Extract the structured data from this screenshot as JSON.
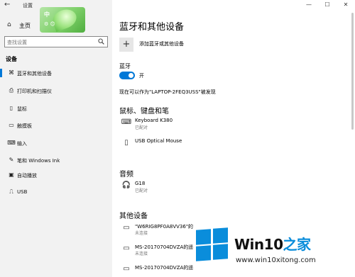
{
  "window": {
    "title": "设置",
    "controls": {
      "minimize": "—",
      "maximize": "☐",
      "close": "✕"
    }
  },
  "ime_badge": {
    "char": "中",
    "sym": "⚙ 😊"
  },
  "sidebar": {
    "home_label": "主页",
    "search_placeholder": "查找设置",
    "section_title": "设备",
    "items": [
      {
        "icon": "bluetooth-icon",
        "glyph": "⌘",
        "label": "蓝牙和其他设备"
      },
      {
        "icon": "printer-icon",
        "glyph": "⎙",
        "label": "打印机和扫描仪"
      },
      {
        "icon": "mouse-icon",
        "glyph": "▯",
        "label": "鼠标"
      },
      {
        "icon": "touchpad-icon",
        "glyph": "▭",
        "label": "触摸板"
      },
      {
        "icon": "keyboard-icon",
        "glyph": "⌨",
        "label": "输入"
      },
      {
        "icon": "pen-icon",
        "glyph": "✎",
        "label": "笔和 Windows Ink"
      },
      {
        "icon": "autoplay-icon",
        "glyph": "▣",
        "label": "自动播放"
      },
      {
        "icon": "usb-icon",
        "glyph": "⎍",
        "label": "USB"
      }
    ]
  },
  "main": {
    "title": "蓝牙和其他设备",
    "add_label": "添加蓝牙或其他设备",
    "bluetooth_heading": "蓝牙",
    "toggle_state": "开",
    "discoverable_text": "现在可以作为\"LAPTOP-2FEQ3USS\"被发现",
    "groups": {
      "input": {
        "title": "鼠标、键盘和笔",
        "devices": [
          {
            "icon": "keyboard-icon",
            "glyph": "⌨",
            "name": "Keyboard K380",
            "status": "已配对"
          },
          {
            "icon": "mouse-icon",
            "glyph": "▯",
            "name": "USB Optical Mouse",
            "status": ""
          }
        ]
      },
      "audio": {
        "title": "音频",
        "devices": [
          {
            "icon": "headset-icon",
            "glyph": "🎧",
            "name": "G18",
            "status": "已配对"
          }
        ]
      },
      "other": {
        "title": "其他设备",
        "devices": [
          {
            "icon": "device-icon",
            "glyph": "▭",
            "name": "\"W6RIG8PF0A8VV36\"的",
            "status": "未连接"
          },
          {
            "icon": "device-icon",
            "glyph": "▭",
            "name": "MS-20170704DVZA的遥",
            "status": "未连接"
          },
          {
            "icon": "device-icon",
            "glyph": "▭",
            "name": "MS-20170704DVZA的遥",
            "status": ""
          }
        ]
      }
    }
  },
  "watermark": {
    "brand_a": "Win10",
    "brand_b": "之家",
    "url": "www.win10xitong.com"
  },
  "colors": {
    "accent": "#0078d7",
    "sidebar_bg": "#f2f2f2"
  }
}
